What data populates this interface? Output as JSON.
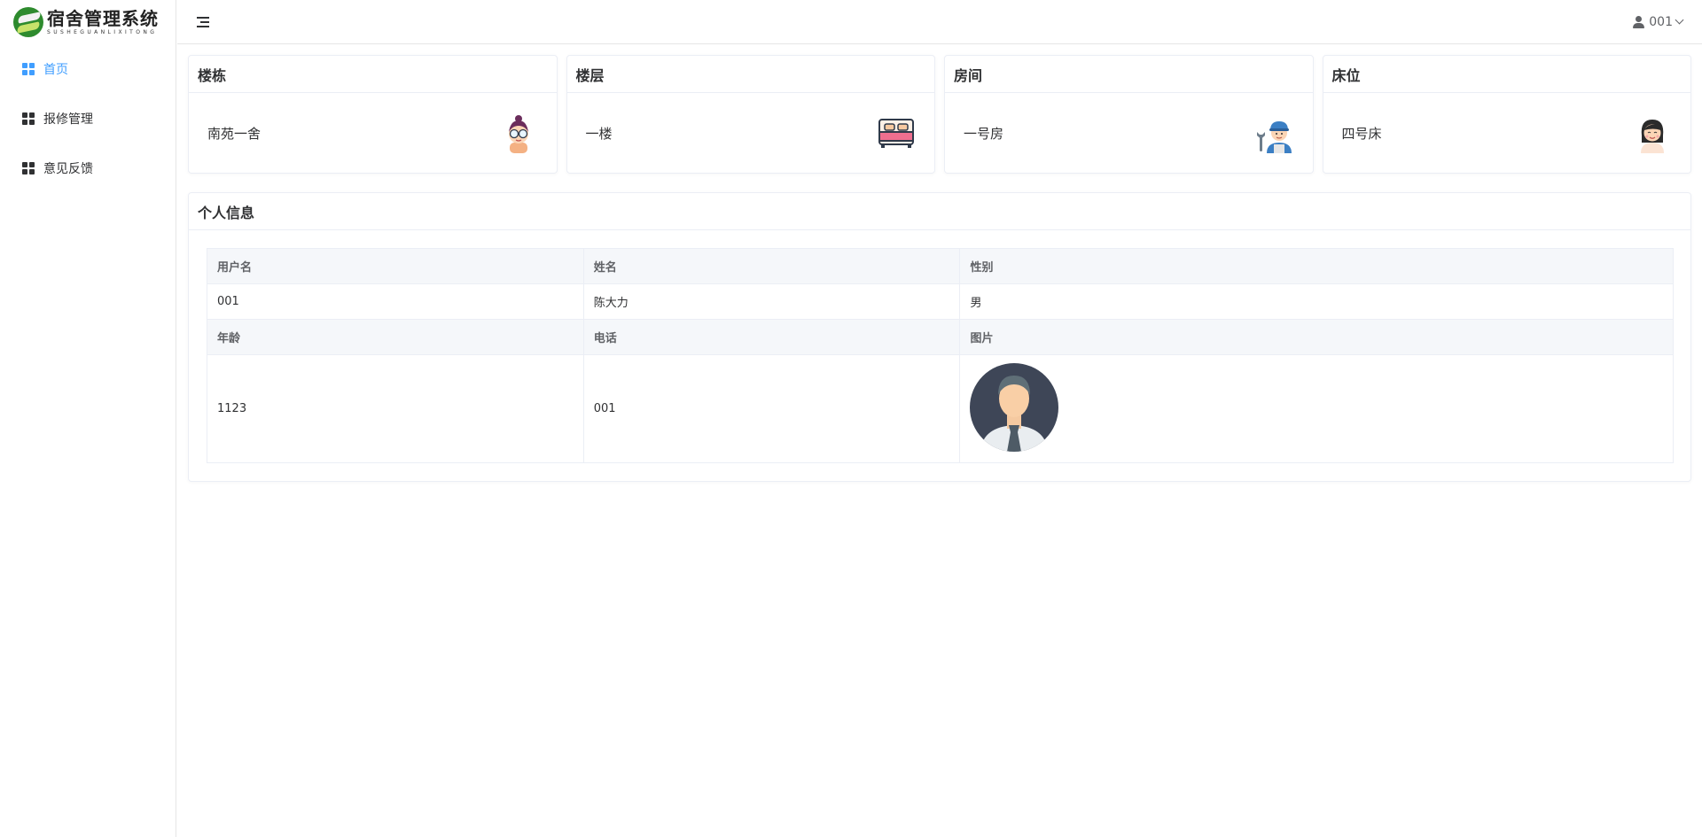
{
  "app": {
    "title": "宿舍管理系统",
    "subtitle": "SUSHEGUANLIXITONG"
  },
  "sidebar": {
    "items": [
      {
        "label": "首页",
        "active": true
      },
      {
        "label": "报修管理",
        "active": false
      },
      {
        "label": "意见反馈",
        "active": false
      }
    ]
  },
  "header": {
    "username": "001"
  },
  "cards": [
    {
      "title": "楼栋",
      "value": "南苑一舍",
      "icon": "girl-glasses-avatar-icon"
    },
    {
      "title": "楼层",
      "value": "一楼",
      "icon": "bed-icon"
    },
    {
      "title": "房间",
      "value": "一号房",
      "icon": "repairman-avatar-icon"
    },
    {
      "title": "床位",
      "value": "四号床",
      "icon": "woman-avatar-icon"
    }
  ],
  "info": {
    "title": "个人信息",
    "labels": {
      "username": "用户名",
      "name": "姓名",
      "gender": "性别",
      "age": "年龄",
      "phone": "电话",
      "photo": "图片"
    },
    "values": {
      "username": "001",
      "name": "陈大力",
      "gender": "男",
      "age": "1123",
      "phone": "001",
      "photo": "man-avatar-icon"
    }
  },
  "colors": {
    "accent": "#409eff",
    "border": "#ebeef5",
    "label_bg": "#f5f7fa"
  }
}
